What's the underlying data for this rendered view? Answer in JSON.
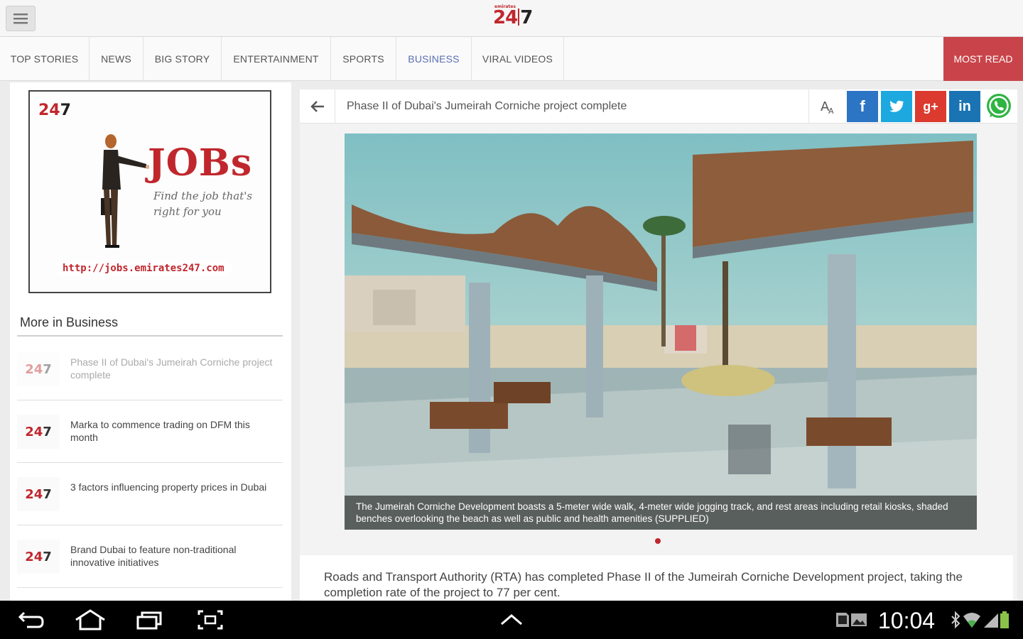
{
  "app": {
    "logo_left": "24",
    "logo_right": "7",
    "logo_tiny": "emirates"
  },
  "nav": {
    "tabs": [
      {
        "label": "TOP STORIES",
        "active": false
      },
      {
        "label": "NEWS",
        "active": false
      },
      {
        "label": "BIG STORY",
        "active": false
      },
      {
        "label": "ENTERTAINMENT",
        "active": false
      },
      {
        "label": "SPORTS",
        "active": false
      },
      {
        "label": "BUSINESS",
        "active": true
      },
      {
        "label": "VIRAL VIDEOS",
        "active": false
      }
    ],
    "most_read": "MOST READ"
  },
  "ad": {
    "logo_left": "24",
    "logo_right": "7",
    "headline": "JOBs",
    "tagline": "Find the job that's right for you",
    "url": "http://jobs.emirates247.com"
  },
  "more": {
    "title": "More in Business",
    "items": [
      {
        "title": "Phase II of Dubai's Jumeirah Corniche project complete",
        "faded": true
      },
      {
        "title": "Marka to commence trading on DFM this month",
        "faded": false
      },
      {
        "title": "3 factors influencing property prices in Dubai",
        "faded": false
      },
      {
        "title": "Brand Dubai to feature non-traditional innovative initiatives",
        "faded": false
      }
    ],
    "thumb_left": "24",
    "thumb_right": "7"
  },
  "article": {
    "title": "Phase II of Dubai's Jumeirah Corniche project complete",
    "font_icon": "A̅",
    "caption": "The Jumeirah Corniche Development boasts a 5-meter wide walk, 4-meter wide jogging track, and rest areas including retail kiosks, shaded benches overlooking the beach as well as public and health amenities (SUPPLIED)",
    "body": "Roads and Transport Authority (RTA) has completed Phase II of the Jumeirah Corniche Development project, taking the completion rate of the project to 77 per cent."
  },
  "share": {
    "facebook": "f",
    "twitter": "t",
    "googleplus": "g+",
    "linkedin": "in"
  },
  "system": {
    "time": "10:04"
  },
  "colors": {
    "brand_red": "#c0272d",
    "active_tab": "#5a6fb3",
    "most_read_bg": "#c9444a"
  }
}
